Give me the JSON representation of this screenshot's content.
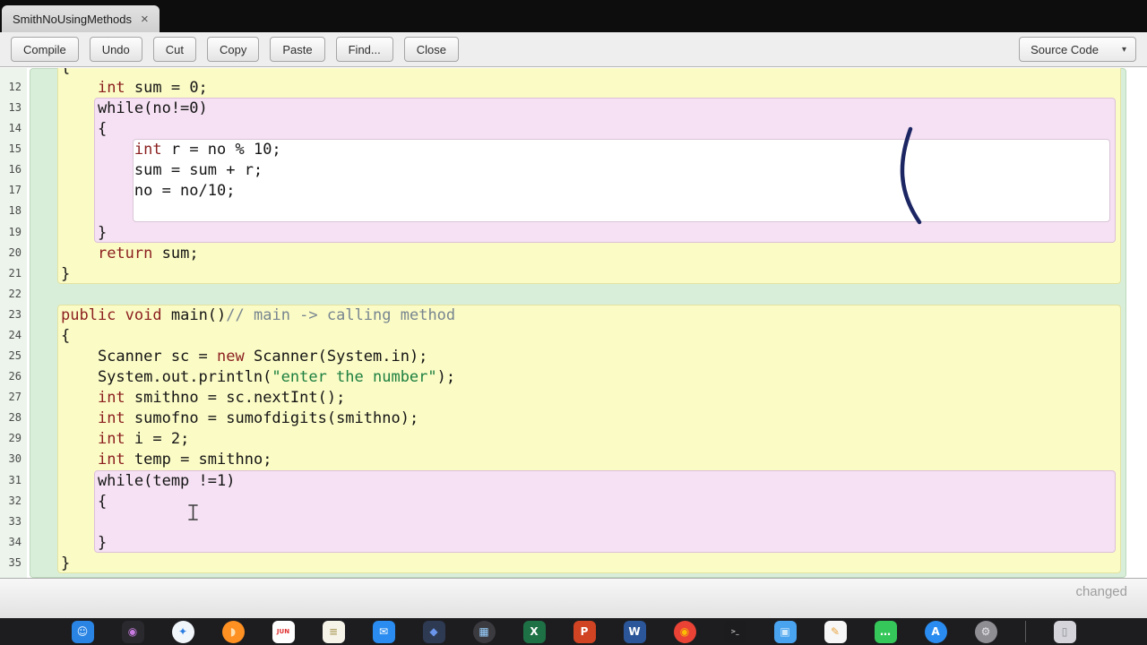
{
  "window": {
    "tab_title": "SmithNoUsingMethods",
    "tab_close_glyph": "×"
  },
  "toolbar": {
    "buttons": [
      {
        "name": "compile-button",
        "label": "Compile"
      },
      {
        "name": "undo-button",
        "label": "Undo"
      },
      {
        "name": "cut-button",
        "label": "Cut"
      },
      {
        "name": "copy-button",
        "label": "Copy"
      },
      {
        "name": "paste-button",
        "label": "Paste"
      },
      {
        "name": "find-button",
        "label": "Find..."
      },
      {
        "name": "close-button",
        "label": "Close"
      }
    ],
    "source_selector": {
      "label": "Source Code",
      "chevron_glyph": "▾"
    }
  },
  "editor": {
    "scope_colors": {
      "class": {
        "bg": "#d9eed9",
        "border": "#bcd9bc"
      },
      "method": {
        "bg": "#fbfbc6",
        "border": "#e3e3a0"
      },
      "loop": {
        "bg": "#f5e1f3",
        "border": "#dcc0da"
      },
      "block": {
        "bg": "#ffffff",
        "border": "#d9c6d7"
      }
    },
    "token_colors": {
      "p": "#141414",
      "k": "#8b1f1f",
      "c": "#77858f",
      "s": "#1c7f3f"
    },
    "scopes": [
      {
        "role": "class"
      },
      {
        "role": "method",
        "start": 11,
        "end": 21
      },
      {
        "role": "loop",
        "start": 13,
        "end": 19
      },
      {
        "role": "block",
        "start": 15,
        "end": 18
      },
      {
        "role": "method",
        "start": 23,
        "end": 35
      },
      {
        "role": "loop",
        "start": 31,
        "end": 34
      }
    ],
    "lines": [
      {
        "i": 11,
        "num": "",
        "tokens": [
          {
            "t": "{",
            "c": "p"
          }
        ]
      },
      {
        "i": 12,
        "num": "12",
        "tokens": [
          {
            "t": "    ",
            "c": "p"
          },
          {
            "t": "int",
            "c": "k"
          },
          {
            "t": " sum = 0;",
            "c": "p"
          }
        ]
      },
      {
        "i": 13,
        "num": "13",
        "tokens": [
          {
            "t": "    while(no!=0)",
            "c": "p"
          }
        ]
      },
      {
        "i": 14,
        "num": "14",
        "tokens": [
          {
            "t": "    {",
            "c": "p"
          }
        ]
      },
      {
        "i": 15,
        "num": "15",
        "tokens": [
          {
            "t": "        ",
            "c": "p"
          },
          {
            "t": "int",
            "c": "k"
          },
          {
            "t": " r = no % 10;",
            "c": "p"
          }
        ]
      },
      {
        "i": 16,
        "num": "16",
        "tokens": [
          {
            "t": "        sum = sum + r;",
            "c": "p"
          }
        ]
      },
      {
        "i": 17,
        "num": "17",
        "tokens": [
          {
            "t": "        no = no/10;",
            "c": "p"
          }
        ]
      },
      {
        "i": 18,
        "num": "18",
        "tokens": []
      },
      {
        "i": 19,
        "num": "19",
        "tokens": [
          {
            "t": "    }",
            "c": "p"
          }
        ]
      },
      {
        "i": 20,
        "num": "20",
        "tokens": [
          {
            "t": "    ",
            "c": "p"
          },
          {
            "t": "return",
            "c": "k"
          },
          {
            "t": " sum;",
            "c": "p"
          }
        ]
      },
      {
        "i": 21,
        "num": "21",
        "tokens": [
          {
            "t": "}",
            "c": "p"
          }
        ]
      },
      {
        "i": 22,
        "num": "22",
        "tokens": []
      },
      {
        "i": 23,
        "num": "23",
        "tokens": [
          {
            "t": "public",
            "c": "k"
          },
          {
            "t": " ",
            "c": "p"
          },
          {
            "t": "void",
            "c": "k"
          },
          {
            "t": " main()",
            "c": "p"
          },
          {
            "t": "// main -> calling method",
            "c": "c"
          }
        ]
      },
      {
        "i": 24,
        "num": "24",
        "tokens": [
          {
            "t": "{",
            "c": "p"
          }
        ]
      },
      {
        "i": 25,
        "num": "25",
        "tokens": [
          {
            "t": "    Scanner sc = ",
            "c": "p"
          },
          {
            "t": "new",
            "c": "k"
          },
          {
            "t": " Scanner(System.in);",
            "c": "p"
          }
        ]
      },
      {
        "i": 26,
        "num": "26",
        "tokens": [
          {
            "t": "    System.out.println(",
            "c": "p"
          },
          {
            "t": "\"enter the number\"",
            "c": "s"
          },
          {
            "t": ");",
            "c": "p"
          }
        ]
      },
      {
        "i": 27,
        "num": "27",
        "tokens": [
          {
            "t": "    ",
            "c": "p"
          },
          {
            "t": "int",
            "c": "k"
          },
          {
            "t": " smithno = sc.nextInt();",
            "c": "p"
          }
        ]
      },
      {
        "i": 28,
        "num": "28",
        "tokens": [
          {
            "t": "    ",
            "c": "p"
          },
          {
            "t": "int",
            "c": "k"
          },
          {
            "t": " sumofno = sumofdigits(smithno);",
            "c": "p"
          }
        ]
      },
      {
        "i": 29,
        "num": "29",
        "tokens": [
          {
            "t": "    ",
            "c": "p"
          },
          {
            "t": "int",
            "c": "k"
          },
          {
            "t": " i = 2;",
            "c": "p"
          }
        ]
      },
      {
        "i": 30,
        "num": "30",
        "tokens": [
          {
            "t": "    ",
            "c": "p"
          },
          {
            "t": "int",
            "c": "k"
          },
          {
            "t": " temp = smithno;",
            "c": "p"
          }
        ]
      },
      {
        "i": 31,
        "num": "31",
        "tokens": [
          {
            "t": "    while(temp !=1)",
            "c": "p"
          }
        ]
      },
      {
        "i": 32,
        "num": "32",
        "tokens": [
          {
            "t": "    {",
            "c": "p"
          }
        ]
      },
      {
        "i": 33,
        "num": "33",
        "tokens": []
      },
      {
        "i": 34,
        "num": "34",
        "tokens": [
          {
            "t": "    }",
            "c": "p"
          }
        ]
      },
      {
        "i": 35,
        "num": "35",
        "tokens": [
          {
            "t": "}",
            "c": "p"
          }
        ]
      }
    ]
  },
  "status": {
    "changed_label": "changed"
  },
  "annotation": {
    "pen_color": "#1c2663"
  },
  "dock": {
    "items": [
      {
        "name": "finder",
        "bg": "#2a84e4",
        "fg": "#eaf6ff",
        "glyph": "☺",
        "shape": "rounded"
      },
      {
        "name": "photo-booth",
        "bg": "#2a2a2e",
        "fg": "#c77ae0",
        "glyph": "◉",
        "shape": "rounded"
      },
      {
        "name": "safari",
        "bg": "#f1f6fb",
        "fg": "#2a7de1",
        "glyph": "✦",
        "shape": "circle"
      },
      {
        "name": "firefox",
        "bg": "#ff9022",
        "fg": "#ffe0b0",
        "glyph": "◗",
        "shape": "circle"
      },
      {
        "name": "calendar",
        "bg": "#ffffff",
        "fg": "#e03131",
        "glyph": "JUN",
        "shape": "rounded"
      },
      {
        "name": "notes",
        "bg": "#f6f3e9",
        "fg": "#b3a468",
        "glyph": "≡",
        "shape": "rounded"
      },
      {
        "name": "mail",
        "bg": "#2a8cf0",
        "fg": "#ffffff",
        "glyph": "✉",
        "shape": "rounded"
      },
      {
        "name": "maps",
        "bg": "#2d3a52",
        "fg": "#6a95ea",
        "glyph": "◆",
        "shape": "rounded"
      },
      {
        "name": "launchpad",
        "bg": "#3b3b3f",
        "fg": "#9ad0ff",
        "glyph": "▦",
        "shape": "circle"
      },
      {
        "name": "excel",
        "bg": "#1e7145",
        "fg": "#ffffff",
        "glyph": "X",
        "shape": "rounded"
      },
      {
        "name": "powerpoint",
        "bg": "#d04423",
        "fg": "#ffffff",
        "glyph": "P",
        "shape": "rounded"
      },
      {
        "name": "word",
        "bg": "#2b579a",
        "fg": "#ffffff",
        "glyph": "W",
        "shape": "rounded"
      },
      {
        "name": "chrome",
        "bg": "#ea4335",
        "fg": "#fbbc05",
        "glyph": "◉",
        "shape": "circle"
      },
      {
        "name": "terminal",
        "bg": "#1c1c1e",
        "fg": "#cfcfcf",
        "glyph": ">_",
        "shape": "rounded"
      },
      {
        "name": "folder-downloads",
        "bg": "#4aa3ef",
        "fg": "#cde7fb",
        "glyph": "▣",
        "shape": "rounded"
      },
      {
        "name": "pages",
        "bg": "#f7f7f7",
        "fg": "#e8a33d",
        "glyph": "✎",
        "shape": "rounded"
      },
      {
        "name": "messages",
        "bg": "#35c759",
        "fg": "#ffffff",
        "glyph": "…",
        "shape": "rounded"
      },
      {
        "name": "app-store",
        "bg": "#2a8cf0",
        "fg": "#ffffff",
        "glyph": "A",
        "shape": "circle"
      },
      {
        "name": "system-preferences",
        "bg": "#8e8e93",
        "fg": "#e5e5ea",
        "glyph": "⚙",
        "shape": "circle"
      },
      {
        "name": "divider",
        "divider": true
      },
      {
        "name": "trash",
        "bg": "#d4d4da",
        "fg": "#8a8a92",
        "glyph": "▯",
        "shape": "rounded"
      }
    ]
  }
}
